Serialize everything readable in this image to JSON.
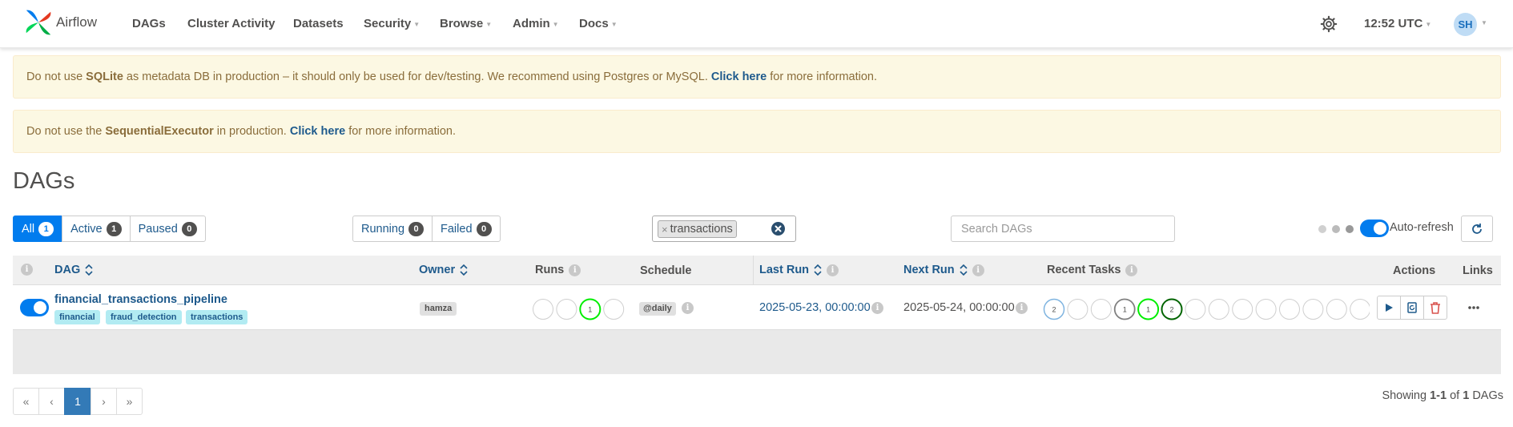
{
  "nav": {
    "brand": "Airflow",
    "items": [
      {
        "label": "DAGs",
        "dropdown": false
      },
      {
        "label": "Cluster Activity",
        "dropdown": false
      },
      {
        "label": "Datasets",
        "dropdown": false
      },
      {
        "label": "Security",
        "dropdown": true
      },
      {
        "label": "Browse",
        "dropdown": true
      },
      {
        "label": "Admin",
        "dropdown": true
      },
      {
        "label": "Docs",
        "dropdown": true
      }
    ],
    "time": "12:52 UTC",
    "user_initials": "SH"
  },
  "alerts": [
    {
      "pre": "Do not use ",
      "strong": "SQLite",
      "mid": " as metadata DB in production – it should only be used for dev/testing. We recommend using Postgres or MySQL. ",
      "link": "Click here",
      "post": " for more information."
    },
    {
      "pre": "Do not use the ",
      "strong": "SequentialExecutor",
      "mid": " in production. ",
      "link": "Click here",
      "post": " for more information."
    }
  ],
  "page_title": "DAGs",
  "status_filters": [
    {
      "label": "All",
      "count": "1",
      "active": true
    },
    {
      "label": "Active",
      "count": "1",
      "active": false
    },
    {
      "label": "Paused",
      "count": "0",
      "active": false
    }
  ],
  "run_filters": [
    {
      "label": "Running",
      "count": "0"
    },
    {
      "label": "Failed",
      "count": "0"
    }
  ],
  "tag_filter": {
    "value": "transactions",
    "remove": "×"
  },
  "search": {
    "placeholder": "Search DAGs"
  },
  "auto_refresh": {
    "label": "Auto-refresh",
    "enabled": true
  },
  "columns": {
    "dag": "DAG",
    "owner": "Owner",
    "runs": "Runs",
    "schedule": "Schedule",
    "last_run": "Last Run",
    "next_run": "Next Run",
    "recent_tasks": "Recent Tasks",
    "actions": "Actions",
    "links": "Links"
  },
  "dags": [
    {
      "id": "financial_transactions_pipeline",
      "active": true,
      "tags": [
        "financial",
        "fraud_detection",
        "transactions"
      ],
      "owner": "hamza",
      "runs": [
        "",
        "",
        "1",
        ""
      ],
      "schedule": "@daily",
      "last_run": "2025-05-23, 00:00:00",
      "next_run": "2025-05-24, 00:00:00",
      "recent_tasks": [
        "2",
        "",
        "",
        "1",
        "1",
        "2",
        "",
        "",
        "",
        "",
        "",
        "",
        "",
        ""
      ]
    }
  ],
  "colors": {
    "accent": "#017cee",
    "link": "#1e5a8c",
    "success": "#00ee00",
    "queued": "#808080",
    "scheduled": "#006400",
    "upstream": "#7fb4e0",
    "delete": "#d9534f"
  },
  "pagination": {
    "first": "«",
    "prev": "‹",
    "current": "1",
    "next": "›",
    "last": "»"
  },
  "showing": {
    "pre": "Showing ",
    "range": "1-1",
    "mid": " of ",
    "total": "1",
    "post": " DAGs"
  }
}
